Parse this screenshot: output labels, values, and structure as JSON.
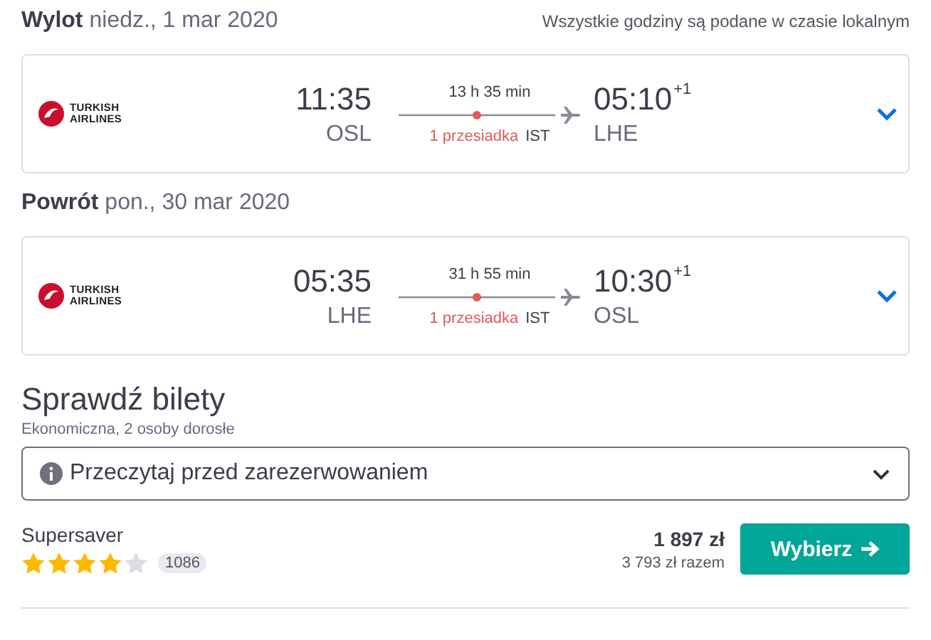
{
  "timezone_note": "Wszystkie godziny są podane w czasie lokalnym",
  "legs": [
    {
      "label": "Wylot",
      "date": "niedz., 1 mar 2020",
      "airline": "TURKISH AIRLINES",
      "departure_time": "11:35",
      "departure_airport": "OSL",
      "duration": "13 h 35 min",
      "stops": "1 przesiadka",
      "stop_airport": "IST",
      "arrival_time": "05:10",
      "day_offset": "+1",
      "arrival_airport": "LHE"
    },
    {
      "label": "Powrót",
      "date": "pon., 30 mar 2020",
      "airline": "TURKISH AIRLINES",
      "departure_time": "05:35",
      "departure_airport": "LHE",
      "duration": "31 h 55 min",
      "stops": "1 przesiadka",
      "stop_airport": "IST",
      "arrival_time": "10:30",
      "day_offset": "+1",
      "arrival_airport": "OSL"
    }
  ],
  "tickets": {
    "title": "Sprawdź bilety",
    "subtitle": "Ekonomiczna, 2 osoby dorosłe",
    "info": "Przeczytaj przed zarezerwowaniem",
    "fare": {
      "name": "Supersaver",
      "stars": 4,
      "reviews": "1086",
      "price": "1 897 zł",
      "total": "3 793 zł razem",
      "button": "Wybierz"
    }
  }
}
